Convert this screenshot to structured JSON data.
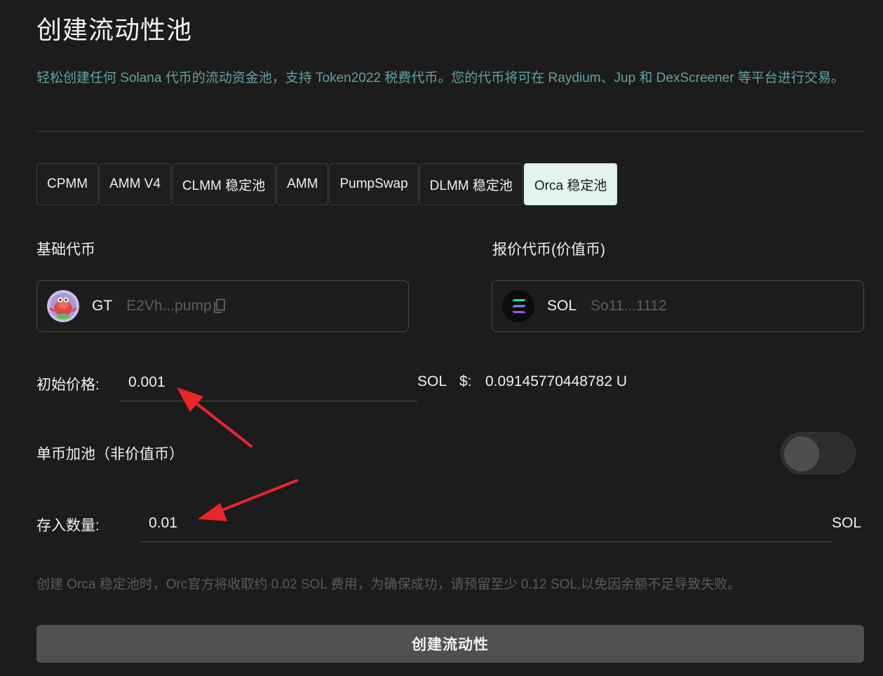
{
  "page": {
    "title": "创建流动性池",
    "description": "轻松创建任何 Solana 代币的流动资金池，支持 Token2022 税费代币。您的代币将可在 Raydium、Jup 和 DexScreener 等平台进行交易。"
  },
  "tabs": [
    {
      "label": "CPMM",
      "active": false
    },
    {
      "label": "AMM V4",
      "active": false
    },
    {
      "label": "CLMM 稳定池",
      "active": false
    },
    {
      "label": "AMM",
      "active": false
    },
    {
      "label": "PumpSwap",
      "active": false
    },
    {
      "label": "DLMM 稳定池",
      "active": false
    },
    {
      "label": "Orca 稳定池",
      "active": true
    }
  ],
  "base_token": {
    "label": "基础代币",
    "symbol": "GT",
    "address": "E2Vh...pump",
    "icon": "gt-token-avatar"
  },
  "quote_token": {
    "label": "报价代币(价值币)",
    "symbol": "SOL",
    "address": "So11...1112",
    "icon": "solana-logo"
  },
  "initial_price": {
    "label": "初始价格:",
    "value": "0.001",
    "unit": "SOL",
    "usd_label": "$:",
    "usd_value": "0.09145770448782 U"
  },
  "single_side": {
    "label": "单币加池（非价值币）",
    "enabled": false
  },
  "deposit": {
    "label": "存入数量:",
    "value": "0.01",
    "unit": "SOL"
  },
  "note": "创建 Orca 稳定池时，Orc官方将收取约 0.02 SOL 费用，为确保成功，请预留至少 0.12 SOL,以免因余额不足导致失败。",
  "submit_label": "创建流动性",
  "colors": {
    "background": "#1c1c1c",
    "accent_text": "#5fa3a1",
    "active_tab": "#e3f3f0",
    "annotation_arrow": "#e8262b"
  }
}
